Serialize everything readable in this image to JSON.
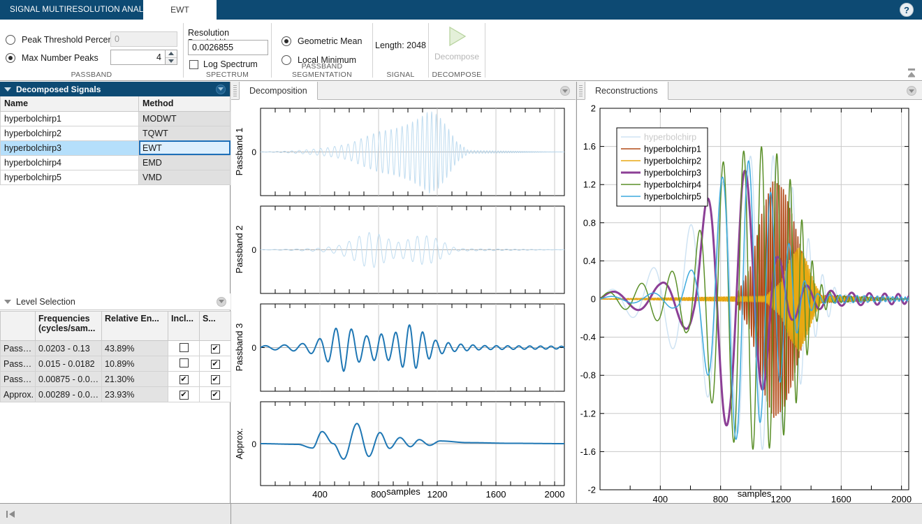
{
  "window": {
    "app_tab_label": "SIGNAL MULTIRESOLUTION ANALYZER",
    "method_tab_label": "EWT",
    "help_icon": "?",
    "title_bg": "#0d4a73"
  },
  "ribbon": {
    "groups": [
      {
        "name": "passband",
        "title": "PASSBAND",
        "peak_threshold_label": "Peak Threshold Percent",
        "peak_threshold_value": "0",
        "peak_threshold_selected": false,
        "max_peaks_label": "Max Number Peaks",
        "max_peaks_value": "4",
        "max_peaks_selected": true
      },
      {
        "name": "spectrum",
        "title": "SPECTRUM",
        "resolution_bandwidth_label": "Resolution Bandwidth",
        "resolution_bandwidth_value": "0.0026855",
        "log_spectrum_label": "Log Spectrum",
        "log_spectrum_checked": false
      },
      {
        "name": "passband-segmentation",
        "title": "PASSBAND SEGMENTATION",
        "geometric_mean_label": "Geometric Mean",
        "geometric_mean_selected": true,
        "local_minimum_label": "Local Minimum",
        "local_minimum_selected": false
      },
      {
        "name": "signal",
        "title": "SIGNAL",
        "length_label": "Length:  2048"
      },
      {
        "name": "decompose",
        "title": "DECOMPOSE",
        "button_label": "Decompose",
        "button_enabled": false
      }
    ],
    "collapse_icon": "collapse-ribbon-icon"
  },
  "sidebar": {
    "decomposed_signals": {
      "title": "Decomposed Signals",
      "columns": [
        "Name",
        "Method"
      ],
      "rows": [
        {
          "name": "hyperbolchirp1",
          "method": "MODWT",
          "selected": false
        },
        {
          "name": "hyperbolchirp2",
          "method": "TQWT",
          "selected": false
        },
        {
          "name": "hyperbolchirp3",
          "method": "EWT",
          "selected": true
        },
        {
          "name": "hyperbolchirp4",
          "method": "EMD",
          "selected": false
        },
        {
          "name": "hyperbolchirp5",
          "method": "VMD",
          "selected": false
        }
      ]
    },
    "level_selection": {
      "title": "Level Selection",
      "columns": [
        "",
        "Frequencies (cycles/sam...",
        "Relative En...",
        "Incl...",
        "S..."
      ],
      "rows": [
        {
          "level": "Pass…",
          "frequencies": "0.0203 - 0.13",
          "relative_energy": "43.89%",
          "include": false,
          "show": true
        },
        {
          "level": "Pass…",
          "frequencies": "0.015 - 0.0182",
          "relative_energy": "10.89%",
          "include": false,
          "show": true
        },
        {
          "level": "Pass…",
          "frequencies": "0.00875 - 0.0…",
          "relative_energy": "21.30%",
          "include": true,
          "show": true
        },
        {
          "level": "Approx.",
          "frequencies": "0.00289 - 0.0…",
          "relative_energy": "23.93%",
          "include": true,
          "show": true
        }
      ]
    }
  },
  "decomposition_panel": {
    "tab_label": "Decomposition",
    "collapse_icon": "panel-menu-icon"
  },
  "reconstructions_panel": {
    "tab_label": "Reconstructions",
    "collapse_icon": "panel-menu-icon"
  },
  "statusbar": {
    "collapse_left_icon": "collapse-left-icon"
  },
  "chart_data": [
    {
      "type": "line",
      "name": "decomposition-passband-1",
      "title": "",
      "ylabel": "Passband 1",
      "xlabel": "",
      "yticks": [
        "0"
      ],
      "xlim": [
        0,
        2048
      ],
      "ylim": [
        -1.35,
        1.35
      ],
      "grid": true,
      "color": "#bfdcf0",
      "linewidth": 1,
      "included": false,
      "xticks": [],
      "xticklabels": [],
      "series": [
        {
          "name": "passband1",
          "description": "High-frequency hyperbolic chirp burst, amplitude grows from ~0.02 near sample 150 to peak ~1.25 at sample ~1140, decays to ~0 by sample 1400",
          "envelope_x": [
            0,
            150,
            300,
            450,
            600,
            700,
            800,
            900,
            1000,
            1080,
            1140,
            1200,
            1260,
            1320,
            1400,
            2048
          ],
          "envelope_y": [
            0,
            0.02,
            0.06,
            0.13,
            0.25,
            0.45,
            0.62,
            0.7,
            0.85,
            1.05,
            1.25,
            1.1,
            0.75,
            0.32,
            0.05,
            0.0
          ],
          "freq_start": 0.02,
          "freq_end": 0.13
        }
      ]
    },
    {
      "type": "line",
      "name": "decomposition-passband-2",
      "title": "",
      "ylabel": "Passband 2",
      "xlabel": "",
      "yticks": [
        "0"
      ],
      "xlim": [
        0,
        2048
      ],
      "ylim": [
        -1.35,
        1.35
      ],
      "grid": true,
      "color": "#bfdcf0",
      "linewidth": 1,
      "included": false,
      "xticks": [],
      "xticklabels": [],
      "series": [
        {
          "name": "passband2",
          "description": "Mid-frequency oscillation packet centered ~sample 700-1200, max amplitude ~0.55",
          "envelope_x": [
            0,
            200,
            400,
            520,
            620,
            700,
            760,
            840,
            920,
            1000,
            1080,
            1160,
            1240,
            1320,
            2048
          ],
          "envelope_y": [
            0,
            0.02,
            0.05,
            0.12,
            0.3,
            0.5,
            0.55,
            0.38,
            0.22,
            0.32,
            0.45,
            0.4,
            0.22,
            0.04,
            0.0
          ],
          "freq_start": 0.015,
          "freq_end": 0.0182
        }
      ]
    },
    {
      "type": "line",
      "name": "decomposition-passband-3",
      "title": "",
      "ylabel": "Passband 3",
      "xlabel": "",
      "yticks": [
        "0"
      ],
      "xlim": [
        0,
        2048
      ],
      "ylim": [
        -1.35,
        1.35
      ],
      "grid": true,
      "color": "#1f77b4",
      "linewidth": 2,
      "included": true,
      "xticks": [],
      "xticklabels": [],
      "series": [
        {
          "name": "passband3",
          "description": "Low-frequency oscillation, two bursts peaking ~0.72 near sample 560 and ~0.72 near sample 1000",
          "envelope_x": [
            0,
            160,
            280,
            380,
            460,
            520,
            560,
            640,
            720,
            800,
            880,
            960,
            1020,
            1100,
            1180,
            1300,
            1500,
            2048
          ],
          "envelope_y": [
            0.05,
            0.08,
            0.12,
            0.22,
            0.45,
            0.62,
            0.72,
            0.48,
            0.35,
            0.42,
            0.38,
            0.6,
            0.72,
            0.45,
            0.22,
            0.12,
            0.06,
            0.04
          ],
          "freq_start": 0.00875,
          "freq_end": 0.015
        }
      ]
    },
    {
      "type": "line",
      "name": "decomposition-approximation",
      "title": "",
      "ylabel": "Approx.",
      "xlabel": "samples",
      "yticks": [
        "0"
      ],
      "xlim": [
        0,
        2048
      ],
      "ylim": [
        -1.0,
        1.0
      ],
      "grid": true,
      "color": "#1f77b4",
      "linewidth": 2,
      "included": true,
      "xticks": [
        400,
        800,
        1200,
        1600,
        2000
      ],
      "xticklabels": [
        "400",
        "800",
        "1200",
        "1600",
        "2000"
      ],
      "series": [
        {
          "name": "approximation",
          "description": "Smooth low-frequency approximation: small dip to -0.13 at ~350, peak 0.36 at ~415, trough -0.46 at ~560, peak 0.60 at ~650, trough -0.38 at ~730, peak 0.33 at ~805, then decaying ripple to zero",
          "key_points_x": [
            0,
            250,
            350,
            415,
            490,
            560,
            650,
            730,
            805,
            870,
            940,
            1010,
            1070,
            1140,
            1210,
            1400,
            1700,
            2048
          ],
          "key_points_y": [
            0,
            -0.02,
            -0.13,
            0.36,
            0.0,
            -0.46,
            0.6,
            -0.38,
            0.33,
            -0.14,
            0.18,
            -0.09,
            0.12,
            -0.05,
            0.08,
            0.03,
            0.01,
            0.0
          ],
          "freq_start": 0.00289,
          "freq_end": 0.00875
        }
      ]
    },
    {
      "type": "line",
      "name": "reconstructions",
      "title": "",
      "xlabel": "samples",
      "ylabel": "",
      "xlim": [
        0,
        2048
      ],
      "ylim": [
        -2,
        2
      ],
      "xticks": [
        400,
        800,
        1200,
        1600,
        2000
      ],
      "xticklabels": [
        "400",
        "800",
        "1200",
        "1600",
        "2000"
      ],
      "yticks": [
        -2,
        -1.6,
        -1.2,
        -0.8,
        -0.4,
        0,
        0.4,
        0.8,
        1.2,
        1.6,
        2
      ],
      "yticklabels": [
        "-2",
        "-1.6",
        "-1.2",
        "-0.8",
        "-0.4",
        "0",
        "0.4",
        "0.8",
        "1.2",
        "1.6",
        "2"
      ],
      "grid": true,
      "legend_position": "upper-left",
      "legend": [
        {
          "label": "hyperbolchirp",
          "color": "#cfe3f3",
          "linewidth": 1.5,
          "text_color": "#c9c9c9"
        },
        {
          "label": "hyperbolchirp1",
          "color": "#b24a17",
          "linewidth": 1.5,
          "text_color": "#000000"
        },
        {
          "label": "hyperbolchirp2",
          "color": "#e8a913",
          "linewidth": 1.5,
          "text_color": "#000000"
        },
        {
          "label": "hyperbolchirp3",
          "color": "#8c3f96",
          "linewidth": 3.0,
          "text_color": "#000000"
        },
        {
          "label": "hyperbolchirp4",
          "color": "#5a8f28",
          "linewidth": 1.5,
          "text_color": "#000000"
        },
        {
          "label": "hyperbolchirp5",
          "color": "#3ba9dd",
          "linewidth": 1.5,
          "text_color": "#000000"
        }
      ],
      "series": [
        {
          "name": "hyperbolchirp",
          "color": "#cfe3f3",
          "linewidth": 1.5,
          "description": "Original signal, hidden behind reconstructions; amplitude envelope up to ~1.6 between samples 700-1400",
          "envelope_x": [
            0,
            300,
            500,
            700,
            900,
            1100,
            1250,
            1350,
            1450,
            1600,
            2048
          ],
          "envelope_y": [
            0.05,
            0.25,
            0.55,
            1.0,
            1.4,
            1.6,
            1.3,
            0.8,
            0.3,
            0.05,
            0.02
          ]
        },
        {
          "name": "hyperbolchirp1",
          "color": "#b24a17",
          "linewidth": 1.5,
          "description": "MODWT reconstruction, highest frequency content, burst from sample ~1000 to ~1400, peak amplitude ~1.25",
          "envelope_x": [
            0,
            900,
            1000,
            1080,
            1150,
            1220,
            1280,
            1340,
            1400,
            1450,
            2048
          ],
          "envelope_y": [
            0.0,
            0.02,
            0.35,
            0.95,
            1.25,
            1.15,
            0.85,
            0.5,
            0.2,
            0.04,
            0.0
          ]
        },
        {
          "name": "hyperbolchirp2",
          "color": "#e8a913",
          "linewidth": 1.5,
          "description": "TQWT reconstruction, very high frequency compressed burst near samples 1250-1420, peak ~0.55",
          "envelope_x": [
            0,
            1100,
            1200,
            1260,
            1320,
            1370,
            1420,
            1470,
            2048
          ],
          "envelope_y": [
            0.0,
            0.03,
            0.18,
            0.42,
            0.55,
            0.4,
            0.18,
            0.03,
            0.0
          ]
        },
        {
          "name": "hyperbolchirp3",
          "color": "#8c3f96",
          "linewidth": 3.0,
          "description": "EWT reconstruction (selected, thick purple). Ripples to -0.4 near sample 620, large swings from ~1.0 down to -1.4 across samples 700-1150, then decaying ripple tail",
          "envelope_x": [
            0,
            200,
            400,
            560,
            620,
            700,
            780,
            860,
            940,
            1020,
            1100,
            1180,
            1280,
            1400,
            1600,
            2048
          ],
          "envelope_y": [
            0.06,
            0.1,
            0.16,
            0.3,
            0.4,
            1.0,
            1.4,
            1.3,
            1.45,
            1.1,
            0.9,
            0.45,
            0.22,
            0.12,
            0.07,
            0.05
          ]
        },
        {
          "name": "hyperbolchirp4",
          "color": "#5a8f28",
          "linewidth": 1.5,
          "description": "EMD reconstruction, wide-band green trace, dips to -0.36 near sample 580, peaks ~1.6 between samples 800-1350",
          "envelope_x": [
            0,
            200,
            400,
            580,
            700,
            820,
            950,
            1080,
            1200,
            1300,
            1380,
            1450,
            1550,
            2048
          ],
          "envelope_y": [
            0.05,
            0.12,
            0.24,
            0.36,
            0.9,
            1.45,
            1.55,
            1.6,
            1.5,
            1.1,
            0.55,
            0.18,
            0.04,
            0.0
          ]
        },
        {
          "name": "hyperbolchirp5",
          "color": "#3ba9dd",
          "linewidth": 1.5,
          "description": "VMD reconstruction, cyan, moderate burst samples 650-1250 with peak ~1.5",
          "envelope_x": [
            0,
            300,
            500,
            650,
            760,
            860,
            960,
            1060,
            1160,
            1250,
            1340,
            1450,
            2048
          ],
          "envelope_y": [
            0.02,
            0.05,
            0.1,
            0.4,
            1.1,
            1.45,
            1.5,
            1.3,
            1.05,
            0.6,
            0.22,
            0.05,
            0.02
          ]
        }
      ]
    }
  ]
}
